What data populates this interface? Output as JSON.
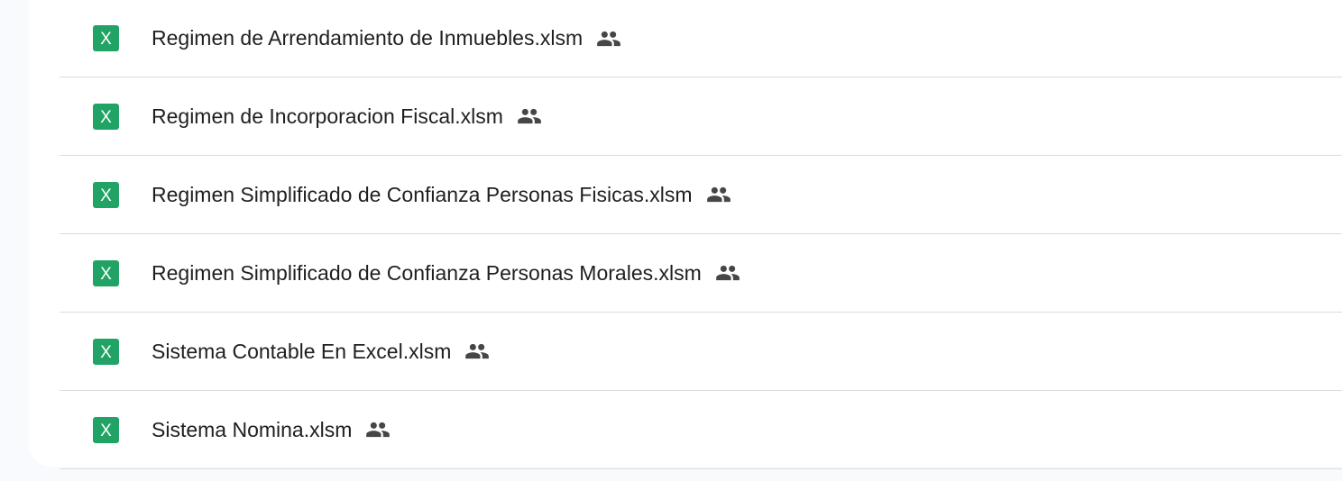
{
  "file_icon": {
    "name": "excel-file-icon",
    "color": "#21a366",
    "glyph": "X"
  },
  "shared_icon": {
    "name": "people-icon",
    "color": "#444746"
  },
  "files": [
    {
      "name": "Regimen de Arrendamiento de Inmuebles.xlsm",
      "shared": true
    },
    {
      "name": "Regimen de Incorporacion Fiscal.xlsm",
      "shared": true
    },
    {
      "name": "Regimen Simplificado de Confianza Personas Fisicas.xlsm",
      "shared": true
    },
    {
      "name": "Regimen Simplificado de Confianza Personas Morales.xlsm",
      "shared": true
    },
    {
      "name": "Sistema Contable En Excel.xlsm",
      "shared": true
    },
    {
      "name": "Sistema Nomina.xlsm",
      "shared": true
    }
  ]
}
